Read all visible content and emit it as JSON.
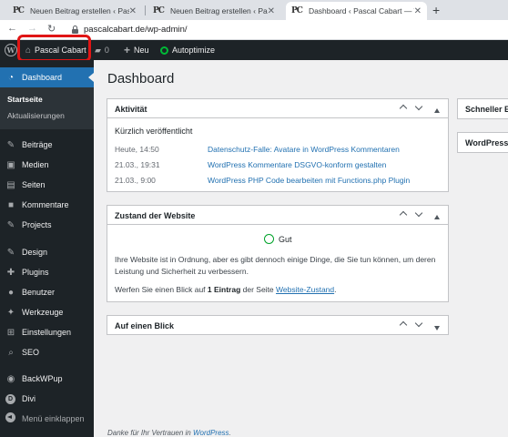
{
  "browser": {
    "tabs": [
      {
        "favicon": "PC",
        "title": "Neuen Beitrag erstellen ‹ Pascal",
        "active": false
      },
      {
        "favicon": "PC",
        "title": "Neuen Beitrag erstellen ‹ Pascal",
        "active": false
      },
      {
        "favicon": "PC",
        "title": "Dashboard ‹ Pascal Cabart — W",
        "active": true
      }
    ],
    "close_glyph": "✕",
    "new_tab_glyph": "+",
    "url": "pascalcabart.de/wp-admin/",
    "nav": {
      "back_glyph": "←",
      "forward_glyph": "→",
      "reload_glyph": "↻"
    }
  },
  "admin_bar": {
    "site_name": "Pascal Cabart",
    "comments_count": "0",
    "new_label": "Neu",
    "autoptimize_label": "Autoptimize",
    "status_color": "#00ba37"
  },
  "sidebar": {
    "dashboard": "Dashboard",
    "submenu": [
      "Startseite",
      "Aktualisierungen"
    ],
    "items": [
      {
        "icon": "pin-icon",
        "glyph": "✎",
        "label": "Beiträge"
      },
      {
        "icon": "media-icon",
        "glyph": "▣",
        "label": "Medien"
      },
      {
        "icon": "pages-icon",
        "glyph": "▤",
        "label": "Seiten"
      },
      {
        "icon": "comment-icon",
        "glyph": "■",
        "label": "Kommentare"
      },
      {
        "icon": "projects-icon",
        "glyph": "✎",
        "label": "Projects"
      },
      {
        "icon": "brush-icon",
        "glyph": "✎",
        "label": "Design"
      },
      {
        "icon": "plugin-icon",
        "glyph": "✚",
        "label": "Plugins"
      },
      {
        "icon": "users-icon",
        "glyph": "●",
        "label": "Benutzer"
      },
      {
        "icon": "wrench-icon",
        "glyph": "✦",
        "label": "Werkzeuge"
      },
      {
        "icon": "settings-icon",
        "glyph": "⊞",
        "label": "Einstellungen"
      },
      {
        "icon": "seo-icon",
        "glyph": "⌕",
        "label": "SEO"
      },
      {
        "icon": "backwpup-icon",
        "glyph": "◉",
        "label": "BackWPup"
      },
      {
        "icon": "divi-icon",
        "glyph": "D",
        "label": "Divi"
      }
    ],
    "collapse_label": "Menü einklappen",
    "accent": "#2271b1"
  },
  "main": {
    "title": "Dashboard",
    "activity": {
      "title": "Aktivität",
      "subtitle": "Kürzlich veröffentlicht",
      "rows": [
        {
          "date": "Heute, 14:50",
          "title": "Datenschutz-Falle: Avatare in WordPress Kommentaren"
        },
        {
          "date": "21.03., 19:31",
          "title": "WordPress Kommentare DSGVO-konform gestalten"
        },
        {
          "date": "21.03., 9:00",
          "title": "WordPress PHP Code bearbeiten mit Functions.php Plugin"
        }
      ]
    },
    "site_health": {
      "title": "Zustand der Website",
      "status": "Gut",
      "status_color": "#00a32a",
      "description": "Ihre Website ist in Ordnung, aber es gibt dennoch einige Dinge, die Sie tun können, um deren Leistung und Sicherheit zu verbessern.",
      "cta_prefix": "Werfen Sie einen Blick auf ",
      "cta_count": "1 Eintrag",
      "cta_mid": " der Seite ",
      "cta_link": "Website-Zustand",
      "cta_suffix": "."
    },
    "at_a_glance": {
      "title": "Auf einen Blick"
    },
    "right_boxes": [
      "Schneller En",
      "WordPress-"
    ],
    "footer_prefix": "Danke für Ihr Vertrauen in ",
    "footer_link": "WordPress",
    "footer_suffix": "."
  }
}
